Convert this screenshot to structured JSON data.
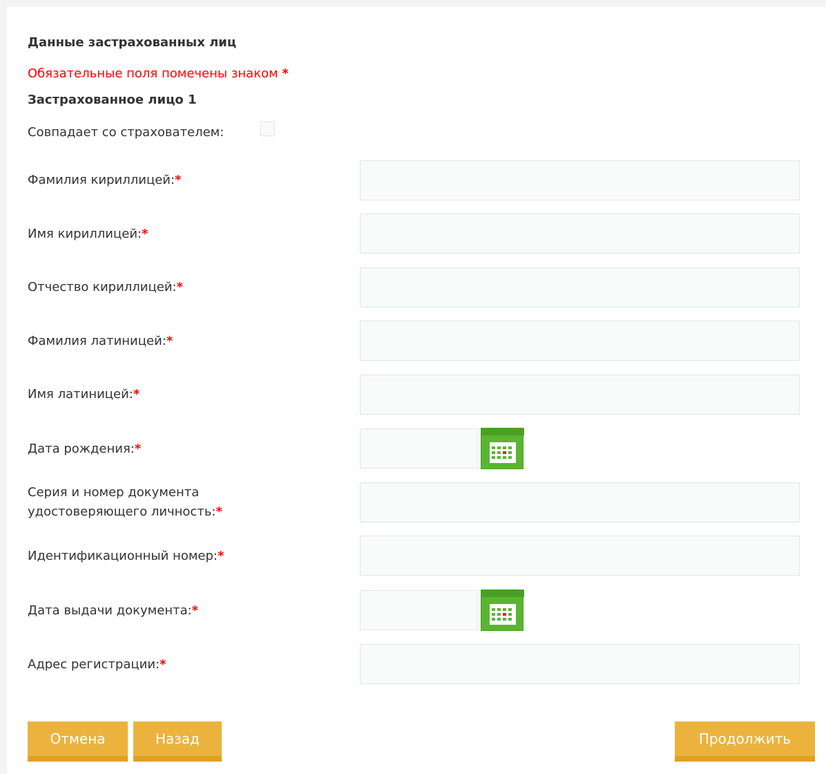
{
  "form": {
    "section_title": "Данные застрахованных лиц",
    "required_note": "Обязательные поля помечены знаком",
    "required_mark": "*",
    "person_title": "Застрахованное лицо 1",
    "same_as_insurer_label": "Совпадает со страхователем:",
    "same_as_insurer_checked": false,
    "fields": {
      "surname_cyr": {
        "label": "Фамилия кириллицей:",
        "value": ""
      },
      "name_cyr": {
        "label": "Имя кириллицей:",
        "value": ""
      },
      "patronymic_cyr": {
        "label": "Отчество кириллицей:",
        "value": ""
      },
      "surname_lat": {
        "label": "Фамилия латиницей:",
        "value": ""
      },
      "name_lat": {
        "label": "Имя латиницей:",
        "value": ""
      },
      "birth_date": {
        "label": "Дата рождения:",
        "value": ""
      },
      "doc_number": {
        "label_line1": "Серия и номер документа",
        "label_line2": "удостоверяющего личность:",
        "value": ""
      },
      "id_number": {
        "label": "Идентификационный номер:",
        "value": ""
      },
      "issue_date": {
        "label": "Дата выдачи документа:",
        "value": ""
      },
      "address": {
        "label": "Адрес регистрации:",
        "value": ""
      }
    }
  },
  "buttons": {
    "cancel": "Отмена",
    "back": "Назад",
    "continue": "Продолжить"
  },
  "icons": {
    "calendar": "calendar-icon"
  },
  "colors": {
    "required": "#ff0000",
    "button": "#ebb33e",
    "button_shadow": "#e0a020",
    "calendar": "#5ab530",
    "input_border": "#dce8e4",
    "input_bg": "#f8fbfa"
  }
}
